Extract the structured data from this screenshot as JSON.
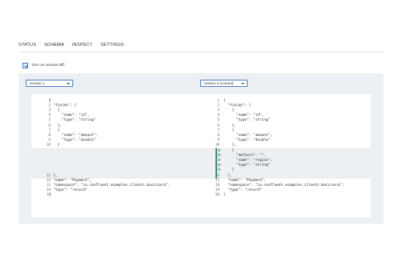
{
  "tabs": [
    {
      "label": "STATUS",
      "active": false
    },
    {
      "label": "SCHEMA",
      "active": true
    },
    {
      "label": "INSPECT",
      "active": false
    },
    {
      "label": "SETTINGS",
      "active": false
    }
  ],
  "diff_toggle": {
    "label": "Turn on version diff",
    "checked": true
  },
  "version_selects": {
    "left": {
      "value": "version 1"
    },
    "right": {
      "value": "version 2 (current)"
    }
  },
  "colors": {
    "accent": "#1f6fc7",
    "added": "#3c9b6c",
    "panel": "#eceff3"
  },
  "left_code": [
    {
      "n": "1",
      "t": "{"
    },
    {
      "n": "2",
      "t": "  \"fields\": ["
    },
    {
      "n": "3",
      "t": "    {"
    },
    {
      "n": "4",
      "t": "      \"name\": \"id\","
    },
    {
      "n": "5",
      "t": "      \"type\": \"string\""
    },
    {
      "n": "6",
      "t": "    },"
    },
    {
      "n": "7",
      "t": "    {"
    },
    {
      "n": "8",
      "t": "      \"name\": \"amount\","
    },
    {
      "n": "9",
      "t": "      \"type\": \"double\""
    },
    {
      "n": "10",
      "t": "    }"
    },
    {
      "n": "11",
      "t": "  ],"
    },
    {
      "n": "12",
      "t": "  \"name\": \"Payment\","
    },
    {
      "n": "13",
      "t": "  \"namespace\": \"io.confluent.examples.clients.basicavro\","
    },
    {
      "n": "14",
      "t": "  \"type\": \"record\""
    },
    {
      "n": "15",
      "t": "}"
    }
  ],
  "right_code": [
    {
      "n": "1",
      "t": "{",
      "added": false
    },
    {
      "n": "2",
      "t": "  \"fields\": [",
      "added": false
    },
    {
      "n": "3",
      "t": "    {",
      "added": false
    },
    {
      "n": "4",
      "t": "      \"name\": \"id\",",
      "added": false
    },
    {
      "n": "5",
      "t": "      \"type\": \"string\"",
      "added": false
    },
    {
      "n": "6",
      "t": "    },",
      "added": false
    },
    {
      "n": "7",
      "t": "    {",
      "added": false
    },
    {
      "n": "8",
      "t": "      \"name\": \"amount\",",
      "added": false
    },
    {
      "n": "9",
      "t": "      \"type\": \"double\"",
      "added": false
    },
    {
      "n": "10",
      "t": "    },",
      "added": false
    },
    {
      "n": "11",
      "t": "    {",
      "added": true
    },
    {
      "n": "12",
      "t": "      \"default\": \"\",",
      "added": true
    },
    {
      "n": "13",
      "t": "      \"name\": \"region\",",
      "added": true
    },
    {
      "n": "14",
      "t": "      \"type\": \"string\"",
      "added": true
    },
    {
      "n": "15",
      "t": "    }",
      "added": true
    },
    {
      "n": "16",
      "t": "  ],",
      "added": false
    },
    {
      "n": "17",
      "t": "  \"name\": \"Payment\",",
      "added": false
    },
    {
      "n": "18",
      "t": "  \"namespace\": \"io.confluent.examples.clients.basicavro\",",
      "added": false
    },
    {
      "n": "19",
      "t": "  \"type\": \"record\"",
      "added": false
    },
    {
      "n": "20",
      "t": "}",
      "added": false
    }
  ],
  "added_marker": "+"
}
